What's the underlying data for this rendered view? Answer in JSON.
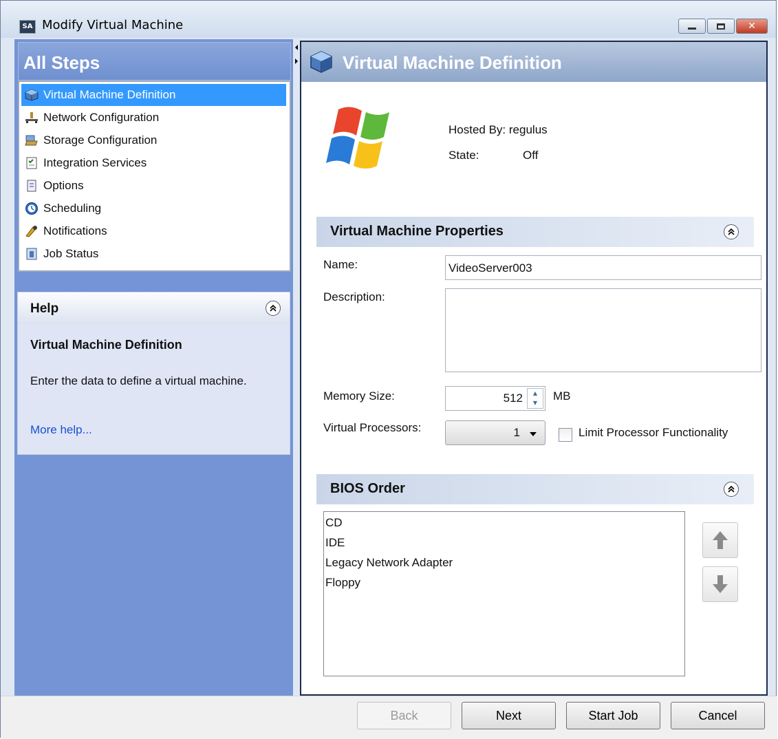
{
  "window": {
    "title": "Modify Virtual Machine",
    "app_icon_text": "SA",
    "close_glyph": "✕"
  },
  "steps": {
    "header": "All Steps",
    "items": [
      {
        "label": "Virtual Machine Definition",
        "icon": "vm-cube-icon",
        "selected": true
      },
      {
        "label": "Network Configuration",
        "icon": "network-icon",
        "selected": false
      },
      {
        "label": "Storage Configuration",
        "icon": "storage-icon",
        "selected": false
      },
      {
        "label": "Integration Services",
        "icon": "checklist-icon",
        "selected": false
      },
      {
        "label": "Options",
        "icon": "options-icon",
        "selected": false
      },
      {
        "label": "Scheduling",
        "icon": "clock-icon",
        "selected": false
      },
      {
        "label": "Notifications",
        "icon": "notification-icon",
        "selected": false
      },
      {
        "label": "Job Status",
        "icon": "job-status-icon",
        "selected": false
      }
    ]
  },
  "help": {
    "header": "Help",
    "title": "Virtual Machine Definition",
    "text": "Enter the data to define a virtual machine.",
    "link": "More help..."
  },
  "main": {
    "header": "Virtual Machine Definition",
    "hosted_by_label": "Hosted By:",
    "hosted_by_value": "regulus",
    "state_label": "State:",
    "state_value": "Off",
    "properties": {
      "header": "Virtual Machine Properties",
      "name_label": "Name:",
      "name_value": "VideoServer003",
      "description_label": "Description:",
      "description_value": "",
      "memory_label": "Memory Size:",
      "memory_value": "512",
      "memory_unit": "MB",
      "processors_label": "Virtual Processors:",
      "processors_value": "1",
      "limit_label": "Limit Processor Functionality",
      "limit_checked": false
    },
    "bios": {
      "header": "BIOS Order",
      "items": [
        "CD",
        "IDE",
        "Legacy Network Adapter",
        "Floppy"
      ]
    }
  },
  "buttons": {
    "back": "Back",
    "next": "Next",
    "start_job": "Start Job",
    "cancel": "Cancel"
  },
  "colors": {
    "selected": "#3399ff",
    "left_bg": "#7594d6",
    "link": "#1a4fd4"
  }
}
